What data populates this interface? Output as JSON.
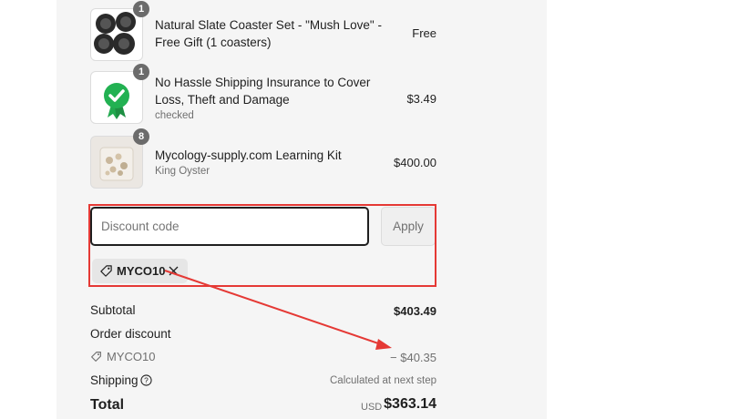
{
  "line_items": [
    {
      "title": "Natural Slate Coaster Set - \"Mush Love\" - Free Gift (1 coasters)",
      "subtitle": "",
      "price": "Free",
      "quantity": "1",
      "icon": "coaster-set-image"
    },
    {
      "title": "No Hassle Shipping Insurance to Cover Loss, Theft and Damage",
      "subtitle": "checked",
      "price": "$3.49",
      "quantity": "1",
      "icon": "shield-check-icon"
    },
    {
      "title": "Mycology-supply.com Learning Kit",
      "subtitle": "King Oyster",
      "price": "$400.00",
      "quantity": "8",
      "icon": "mushroom-kit-image"
    }
  ],
  "discount": {
    "placeholder": "Discount code",
    "apply_label": "Apply",
    "applied_code": "MYCO10"
  },
  "summary": {
    "subtotal_label": "Subtotal",
    "subtotal_value": "$403.49",
    "order_discount_label": "Order discount",
    "discount_code": "MYCO10",
    "discount_value": "− $40.35",
    "shipping_label": "Shipping",
    "shipping_value": "Calculated at next step",
    "total_label": "Total",
    "currency": "USD",
    "total_value": "$363.14"
  },
  "colors": {
    "annotation": "#e53935",
    "badge": "#6b6b6b",
    "panel": "#f5f5f5"
  }
}
